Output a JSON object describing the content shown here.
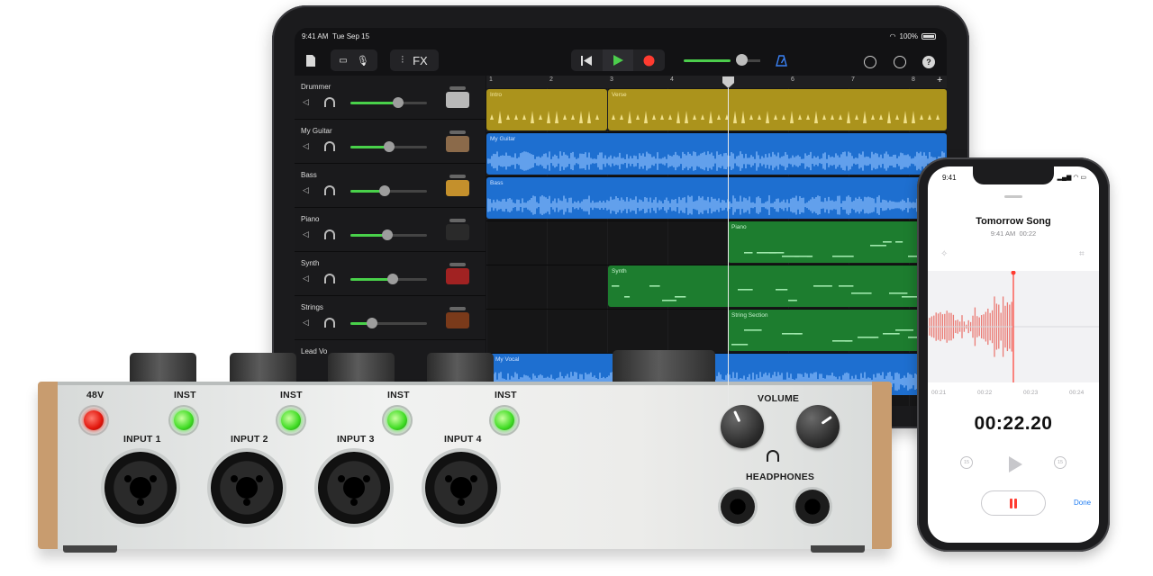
{
  "ipad": {
    "status": {
      "time": "9:41 AM",
      "date": "Tue Sep 15",
      "battery": "100%"
    },
    "toolbar": {
      "fx_label": "FX"
    },
    "ruler": [
      "1",
      "2",
      "3",
      "4",
      "5",
      "6",
      "7",
      "8"
    ],
    "tracks": [
      {
        "name": "Drummer",
        "level": 0.62
      },
      {
        "name": "My Guitar",
        "level": 0.5
      },
      {
        "name": "Bass",
        "level": 0.45
      },
      {
        "name": "Piano",
        "level": 0.48
      },
      {
        "name": "Synth",
        "level": 0.55
      },
      {
        "name": "Strings",
        "level": 0.28
      },
      {
        "name": "Lead Vo"
      }
    ],
    "regions": {
      "intro": "Intro",
      "verse": "Verse",
      "guitar": "My Guitar",
      "bass": "Bass",
      "piano": "Piano",
      "synth": "Synth",
      "strings": "String Section",
      "vocal": "My Vocal"
    },
    "colors": {
      "drummer": "#ab931c",
      "audio": "#1e6fd0",
      "midi": "#1d7d2f"
    }
  },
  "interface": {
    "phantom_label": "48V",
    "inst_labels": [
      "INST",
      "INST",
      "INST",
      "INST"
    ],
    "inputs": [
      "INPUT 1",
      "INPUT 2",
      "INPUT 3",
      "INPUT 4"
    ],
    "volume_label": "VOLUME",
    "headphones_label": "HEADPHONES",
    "colors": {
      "phantom_led": "#e2160c",
      "inst_led": "#3fdc23",
      "wood": "#c89c6f"
    }
  },
  "iphone": {
    "status_time": "9:41",
    "title": "Tomorrow Song",
    "meta_time": "9:41 AM",
    "meta_duration": "00:22",
    "ticks": [
      "00:21",
      "00:22",
      "00:23",
      "00:24"
    ],
    "timer": "00:22.20",
    "skip_back": "15",
    "skip_fwd": "15",
    "done_label": "Done",
    "colors": {
      "record": "#ff3b30",
      "accent": "#1e7cf2"
    }
  }
}
